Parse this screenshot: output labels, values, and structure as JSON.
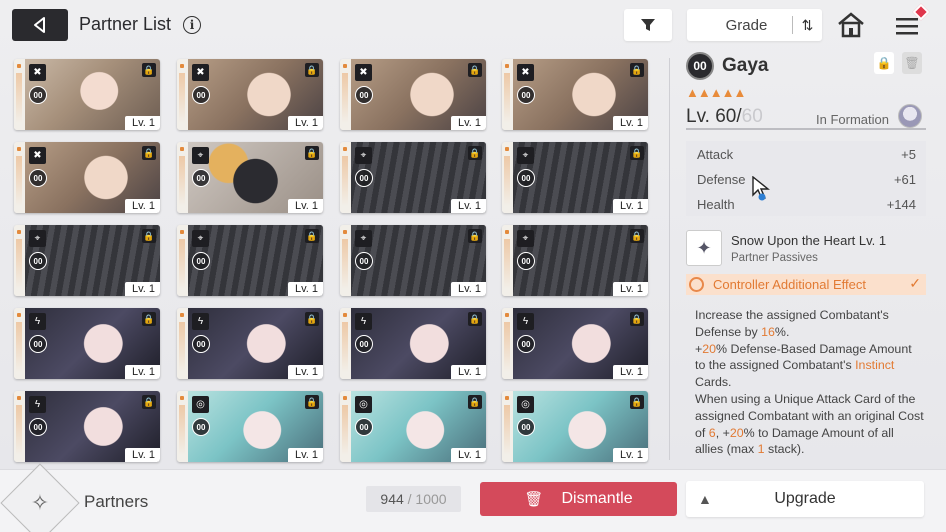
{
  "header": {
    "title": "Partner List",
    "info_glyph": "i",
    "sort_label": "Grade",
    "sort_glyph": "⇅"
  },
  "partners": [
    {
      "type": "strike-icon",
      "type_glyph": "✖",
      "rank": "00",
      "level": "Lv. 1",
      "art": "art-girl-a"
    },
    {
      "type": "strike-icon",
      "type_glyph": "✖",
      "rank": "00",
      "level": "Lv. 1",
      "art": "art-girl-b"
    },
    {
      "type": "strike-icon",
      "type_glyph": "✖",
      "rank": "00",
      "level": "Lv. 1",
      "art": "art-girl-b"
    },
    {
      "type": "strike-icon",
      "type_glyph": "✖",
      "rank": "00",
      "level": "Lv. 1",
      "art": "art-girl-b"
    },
    {
      "type": "strike-icon",
      "type_glyph": "✖",
      "rank": "00",
      "level": "Lv. 1",
      "art": "art-girl-b"
    },
    {
      "type": "target-icon",
      "type_glyph": "⌖",
      "rank": "00",
      "level": "Lv. 1",
      "art": "art-doll"
    },
    {
      "type": "target-icon",
      "type_glyph": "⌖",
      "rank": "00",
      "level": "Lv. 1",
      "art": "art-mech"
    },
    {
      "type": "target-icon",
      "type_glyph": "⌖",
      "rank": "00",
      "level": "Lv. 1",
      "art": "art-mech"
    },
    {
      "type": "target-icon",
      "type_glyph": "⌖",
      "rank": "00",
      "level": "Lv. 1",
      "art": "art-mech"
    },
    {
      "type": "target-icon",
      "type_glyph": "⌖",
      "rank": "00",
      "level": "Lv. 1",
      "art": "art-mech"
    },
    {
      "type": "target-icon",
      "type_glyph": "⌖",
      "rank": "00",
      "level": "Lv. 1",
      "art": "art-mech"
    },
    {
      "type": "target-icon",
      "type_glyph": "⌖",
      "rank": "00",
      "level": "Lv. 1",
      "art": "art-mech"
    },
    {
      "type": "lightning-icon",
      "type_glyph": "ϟ",
      "rank": "00",
      "level": "Lv. 1",
      "art": "art-glasses"
    },
    {
      "type": "lightning-icon",
      "type_glyph": "ϟ",
      "rank": "00",
      "level": "Lv. 1",
      "art": "art-glasses"
    },
    {
      "type": "lightning-icon",
      "type_glyph": "ϟ",
      "rank": "00",
      "level": "Lv. 1",
      "art": "art-glasses"
    },
    {
      "type": "lightning-icon",
      "type_glyph": "ϟ",
      "rank": "00",
      "level": "Lv. 1",
      "art": "art-glasses"
    },
    {
      "type": "lightning-icon",
      "type_glyph": "ϟ",
      "rank": "00",
      "level": "Lv. 1",
      "art": "art-glasses"
    },
    {
      "type": "orb-icon",
      "type_glyph": "◎",
      "rank": "00",
      "level": "Lv. 1",
      "art": "art-teal"
    },
    {
      "type": "orb-icon",
      "type_glyph": "◎",
      "rank": "00",
      "level": "Lv. 1",
      "art": "art-teal"
    },
    {
      "type": "orb-icon",
      "type_glyph": "◎",
      "rank": "00",
      "level": "Lv. 1",
      "art": "art-teal"
    }
  ],
  "detail": {
    "rank": "00",
    "name": "Gaya",
    "stars": "▲▲▲▲▲",
    "level_current": "Lv. 60/",
    "level_max": "60",
    "in_formation": "In Formation",
    "stats": [
      {
        "label": "Attack",
        "value": "+5"
      },
      {
        "label": "Defense",
        "value": "+61"
      },
      {
        "label": "Health",
        "value": "+144"
      }
    ],
    "passive_title": "Snow Upon the Heart Lv. 1",
    "passive_sub": "Partner Passives",
    "effect_label": "Controller Additional Effect",
    "desc": {
      "p1a": "Increase the assigned Combatant's Defense by ",
      "p1b": "16",
      "p1c": "%.",
      "p2a": "+",
      "p2b": "20",
      "p2c": "% Defense-Based Damage Amount to the assigned Combatant's ",
      "p2d": "Instinct",
      "p2e": " Cards.",
      "p3a": "When using a Unique Attack Card of the assigned Combatant with an original Cost of ",
      "p3b": "6",
      "p3c": ", +",
      "p3d": "20",
      "p3e": "% to Damage Amount of all allies (max ",
      "p3f": "1",
      "p3g": " stack)."
    }
  },
  "footer": {
    "section_label": "Partners",
    "count_current": "944",
    "count_max": "/ 1000",
    "dismantle_label": "Dismantle",
    "upgrade_label": "Upgrade"
  },
  "colors": {
    "accent_orange": "#e27a33",
    "dismantle_red": "#d44a5b",
    "dark": "#2a2a2e"
  }
}
